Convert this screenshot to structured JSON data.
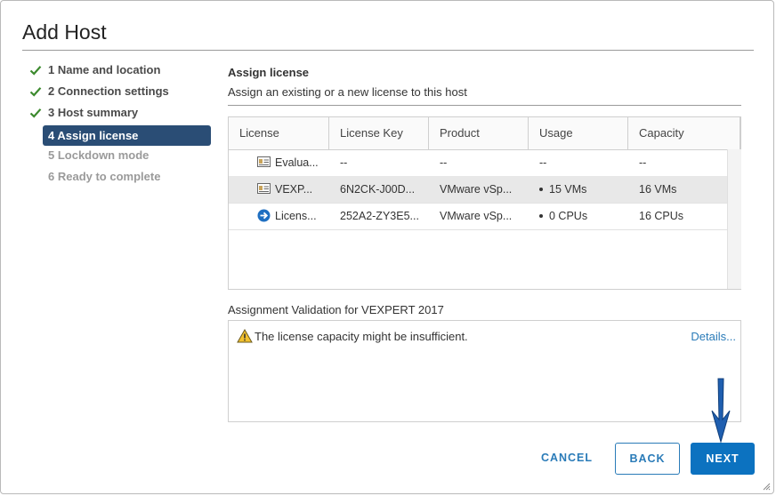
{
  "dialog": {
    "title": "Add Host"
  },
  "steps": [
    {
      "label": "1 Name and location",
      "state": "done"
    },
    {
      "label": "2 Connection settings",
      "state": "done"
    },
    {
      "label": "3 Host summary",
      "state": "done"
    },
    {
      "label": "4 Assign license",
      "state": "active"
    },
    {
      "label": "5 Lockdown mode",
      "state": "disabled"
    },
    {
      "label": "6 Ready to complete",
      "state": "disabled"
    }
  ],
  "section": {
    "title": "Assign license",
    "subtitle": "Assign an existing or a new license to this host"
  },
  "grid": {
    "columns": [
      "License",
      "License Key",
      "Product",
      "Usage",
      "Capacity"
    ],
    "rows": [
      {
        "icon": "license-card-icon",
        "license": "Evalua...",
        "key": "--",
        "product": "--",
        "usage": "--",
        "capacity": "--",
        "selected": false
      },
      {
        "icon": "license-card-icon",
        "license": "VEXP...",
        "key": "6N2CK-J00D...",
        "product": "VMware vSp...",
        "usage": "15 VMs",
        "capacity": "16 VMs",
        "selected": true
      },
      {
        "icon": "new-license-arrow-icon",
        "license": "Licens...",
        "key": "252A2-ZY3E5...",
        "product": "VMware vSp...",
        "usage": "0 CPUs",
        "capacity": "16 CPUs",
        "selected": false
      }
    ]
  },
  "validation": {
    "title": "Assignment Validation for VEXPERT 2017",
    "message": "The license capacity might be insufficient.",
    "details_label": "Details..."
  },
  "footer": {
    "cancel_label": "CANCEL",
    "back_label": "BACK",
    "next_label": "NEXT"
  },
  "colors": {
    "active_step_bg": "#2a4d75",
    "check_green": "#3c8a2e",
    "primary_button": "#0c72c0",
    "link": "#2a7bb8",
    "warning": "#f2c12e"
  }
}
